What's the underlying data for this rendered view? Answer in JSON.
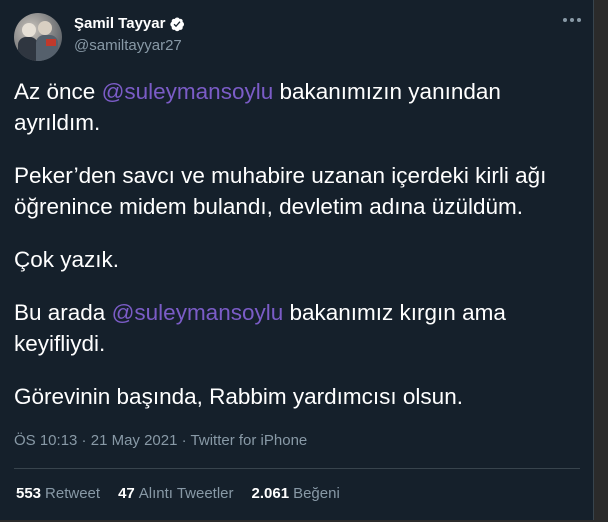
{
  "author": {
    "name": "Şamil Tayyar",
    "handle": "@samiltayyar27",
    "verified": true,
    "verified_color": "#ffffff"
  },
  "tweet": {
    "p1_before": "Az önce ",
    "p1_mention": "@suleymansoylu",
    "p1_after": " bakanımızın yanından ayrıldım.",
    "p2": "Peker’den savcı ve muhabire uzanan içerdeki kirli ağı öğrenince midem bulandı, devletim adına üzüldüm.",
    "p3": "Çok yazık.",
    "p4_before": "Bu arada ",
    "p4_mention": "@suleymansoylu",
    "p4_after": " bakanımız kırgın ama keyifliydi.",
    "p5": "Görevinin başında, Rabbim yardımcısı olsun."
  },
  "meta": {
    "time": "ÖS 10:13",
    "sep1": " · ",
    "date": "21 May 2021",
    "sep2": " · ",
    "source": "Twitter for iPhone"
  },
  "stats": {
    "retweets_count": "553",
    "retweets_label": "Retweet",
    "quotes_count": "47",
    "quotes_label": "Alıntı Tweetler",
    "likes_count": "2.061",
    "likes_label": "Beğeni"
  },
  "colors": {
    "background": "#15202b",
    "mention": "#7b5cc7",
    "secondary_text": "#8899a6",
    "border": "#38444d"
  }
}
